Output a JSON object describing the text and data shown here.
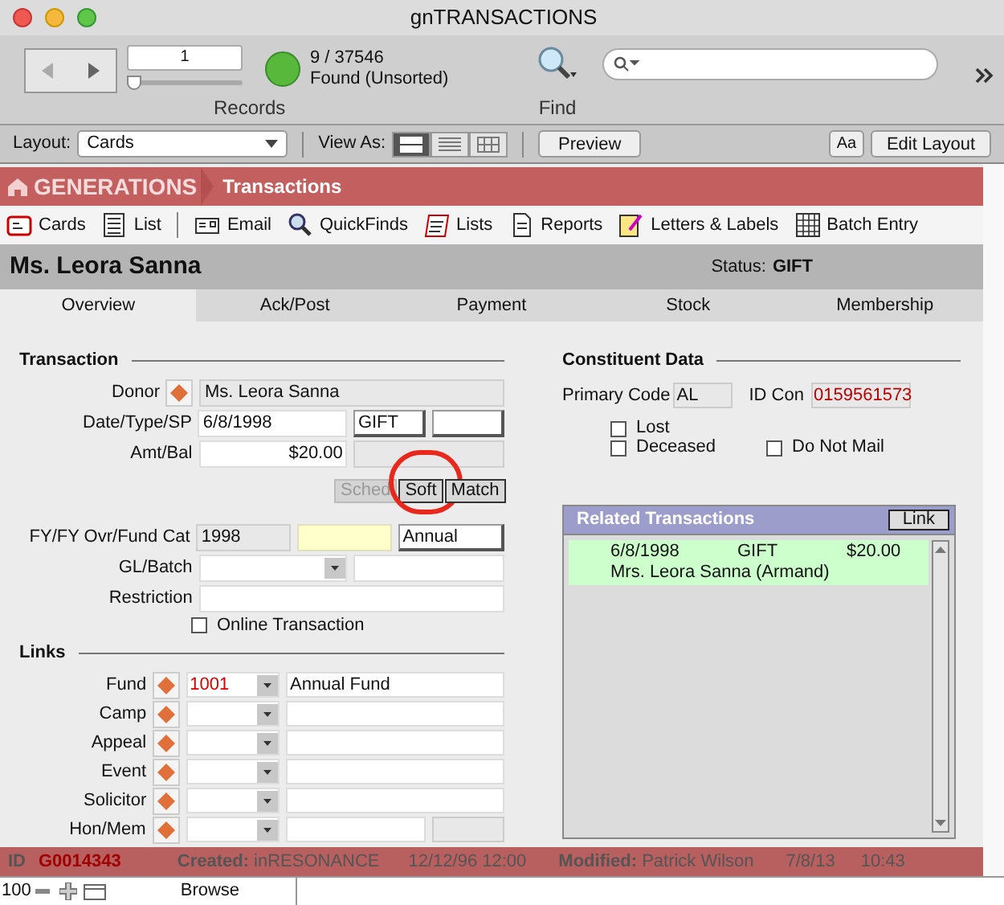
{
  "window": {
    "title": "gnTRANSACTIONS"
  },
  "toolbar": {
    "record": "1",
    "slider": {
      "level": 0
    },
    "found_count": "9 / 37546",
    "found_status": "Found (Unsorted)",
    "records_label": "Records",
    "find_label": "Find"
  },
  "layout_bar": {
    "layout_label": "Layout:",
    "layout_value": "Cards",
    "view_as_label": "View As:",
    "view_modes": [
      {
        "kind": "form",
        "selected": true
      },
      {
        "kind": "list",
        "selected": false
      },
      {
        "kind": "table",
        "selected": false
      }
    ],
    "preview": "Preview",
    "text_button": "Aa",
    "edit_layout": "Edit Layout"
  },
  "header": {
    "brand": "GENERATIONS",
    "section": "Transactions"
  },
  "nav": [
    {
      "label": "Cards",
      "kind": "cards"
    },
    {
      "label": "List",
      "kind": "list"
    },
    {
      "label": "Email",
      "kind": "email"
    },
    {
      "label": "QuickFinds",
      "kind": "quickfinds"
    },
    {
      "label": "Lists",
      "kind": "lists"
    },
    {
      "label": "Reports",
      "kind": "reports"
    },
    {
      "label": "Letters & Labels",
      "kind": "letters"
    },
    {
      "label": "Batch Entry",
      "kind": "batch"
    }
  ],
  "record": {
    "name": "Ms. Leora Sanna",
    "status_label": "Status:",
    "status": "GIFT"
  },
  "tabs": [
    {
      "label": "Overview",
      "selected": true
    },
    {
      "label": "Ack/Post",
      "selected": false
    },
    {
      "label": "Payment",
      "selected": false
    },
    {
      "label": "Stock",
      "selected": false
    },
    {
      "label": "Membership",
      "selected": false
    }
  ],
  "transaction": {
    "title": "Transaction",
    "rows": [
      {
        "label": "Donor",
        "lookup": true,
        "fields": [
          {
            "kind": "gray",
            "value": "Ms. Leora Sanna"
          }
        ]
      },
      {
        "label": "Date/Type/SP",
        "lookup": false,
        "fields": [
          {
            "kind": "text",
            "value": "6/8/1998"
          },
          {
            "kind": "boxed",
            "value": "GIFT"
          },
          {
            "kind": "boxed"
          }
        ]
      },
      {
        "label": "Amt/Bal",
        "lookup": false,
        "fields": [
          {
            "kind": "text",
            "value": "$20.00"
          },
          {
            "kind": "gray"
          }
        ]
      }
    ],
    "buttons": [
      {
        "label": "Sched",
        "disabled": true,
        "circled": false
      },
      {
        "label": "Soft",
        "disabled": false,
        "circled": true
      },
      {
        "label": "Match",
        "disabled": false,
        "circled": false
      }
    ],
    "rows2": [
      {
        "label": "FY/FY Ovr/Fund Cat",
        "lookup": false,
        "fields": [
          {
            "kind": "gray",
            "value": "1998"
          },
          {
            "kind": "yellow"
          },
          {
            "kind": "boxed",
            "value": "Annual"
          }
        ]
      },
      {
        "label": "GL/Batch",
        "lookup": false,
        "fields": [
          {
            "kind": "dropdown"
          },
          {
            "kind": "text"
          }
        ]
      },
      {
        "label": "Restriction",
        "lookup": false,
        "fields": [
          {
            "kind": "text"
          }
        ]
      }
    ],
    "online": {
      "label": "Online Transaction",
      "checked": false
    }
  },
  "links": {
    "title": "Links",
    "rows": [
      {
        "label": "Fund",
        "code": "1001",
        "name": "Annual Fund",
        "extra": false
      },
      {
        "label": "Camp",
        "extra": false
      },
      {
        "label": "Appeal",
        "extra": false
      },
      {
        "label": "Event",
        "extra": false
      },
      {
        "label": "Solicitor",
        "extra": false
      },
      {
        "label": "Hon/Mem",
        "extra": true
      }
    ]
  },
  "constituent": {
    "title": "Constituent Data",
    "primary_code_label": "Primary Code",
    "primary_code": "AL",
    "id_label": "ID Con",
    "id": "0159561573",
    "flags": [
      {
        "label": "Lost",
        "checked": false
      },
      {
        "label": "Deceased",
        "checked": false
      },
      {
        "label": "Do Not Mail",
        "checked": false
      }
    ]
  },
  "related": {
    "title": "Related Transactions",
    "link_button": "Link",
    "rows": [
      {
        "date": "6/8/1998",
        "type": "GIFT",
        "amount": "$20.00",
        "name": "Mrs. Leora Sanna (Armand)"
      }
    ]
  },
  "footer": {
    "id_label": "ID",
    "id": "G0014343",
    "created_label": "Created:",
    "created_by": "inRESONANCE",
    "created_at": "12/12/96 12:00",
    "modified_label": "Modified:",
    "modified_by": "Patrick Wilson",
    "modified_date": "7/8/13",
    "modified_time": "10:43"
  },
  "status_bar": {
    "zoom": "100",
    "mode": "Browse"
  }
}
